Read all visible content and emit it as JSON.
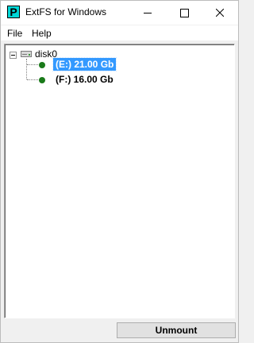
{
  "window": {
    "title": "ExtFS for Windows",
    "icon_letter": "P",
    "icon_color": "#00d8d8",
    "minimize_icon": "minimize-icon",
    "maximize_icon": "maximize-icon",
    "close_icon": "close-icon"
  },
  "menu": {
    "file": "File",
    "help": "Help"
  },
  "tree": {
    "disk": {
      "label": "disk0",
      "icon": "disk-icon",
      "expanded": true
    },
    "partitions": [
      {
        "label": "(E:) 21.00 Gb",
        "selected": true,
        "status_color": "#1a7a1a"
      },
      {
        "label": "(F:) 16.00 Gb",
        "selected": false,
        "status_color": "#1a7a1a"
      }
    ],
    "selection_color": "#3399ff"
  },
  "actions": {
    "unmount": "Unmount"
  }
}
